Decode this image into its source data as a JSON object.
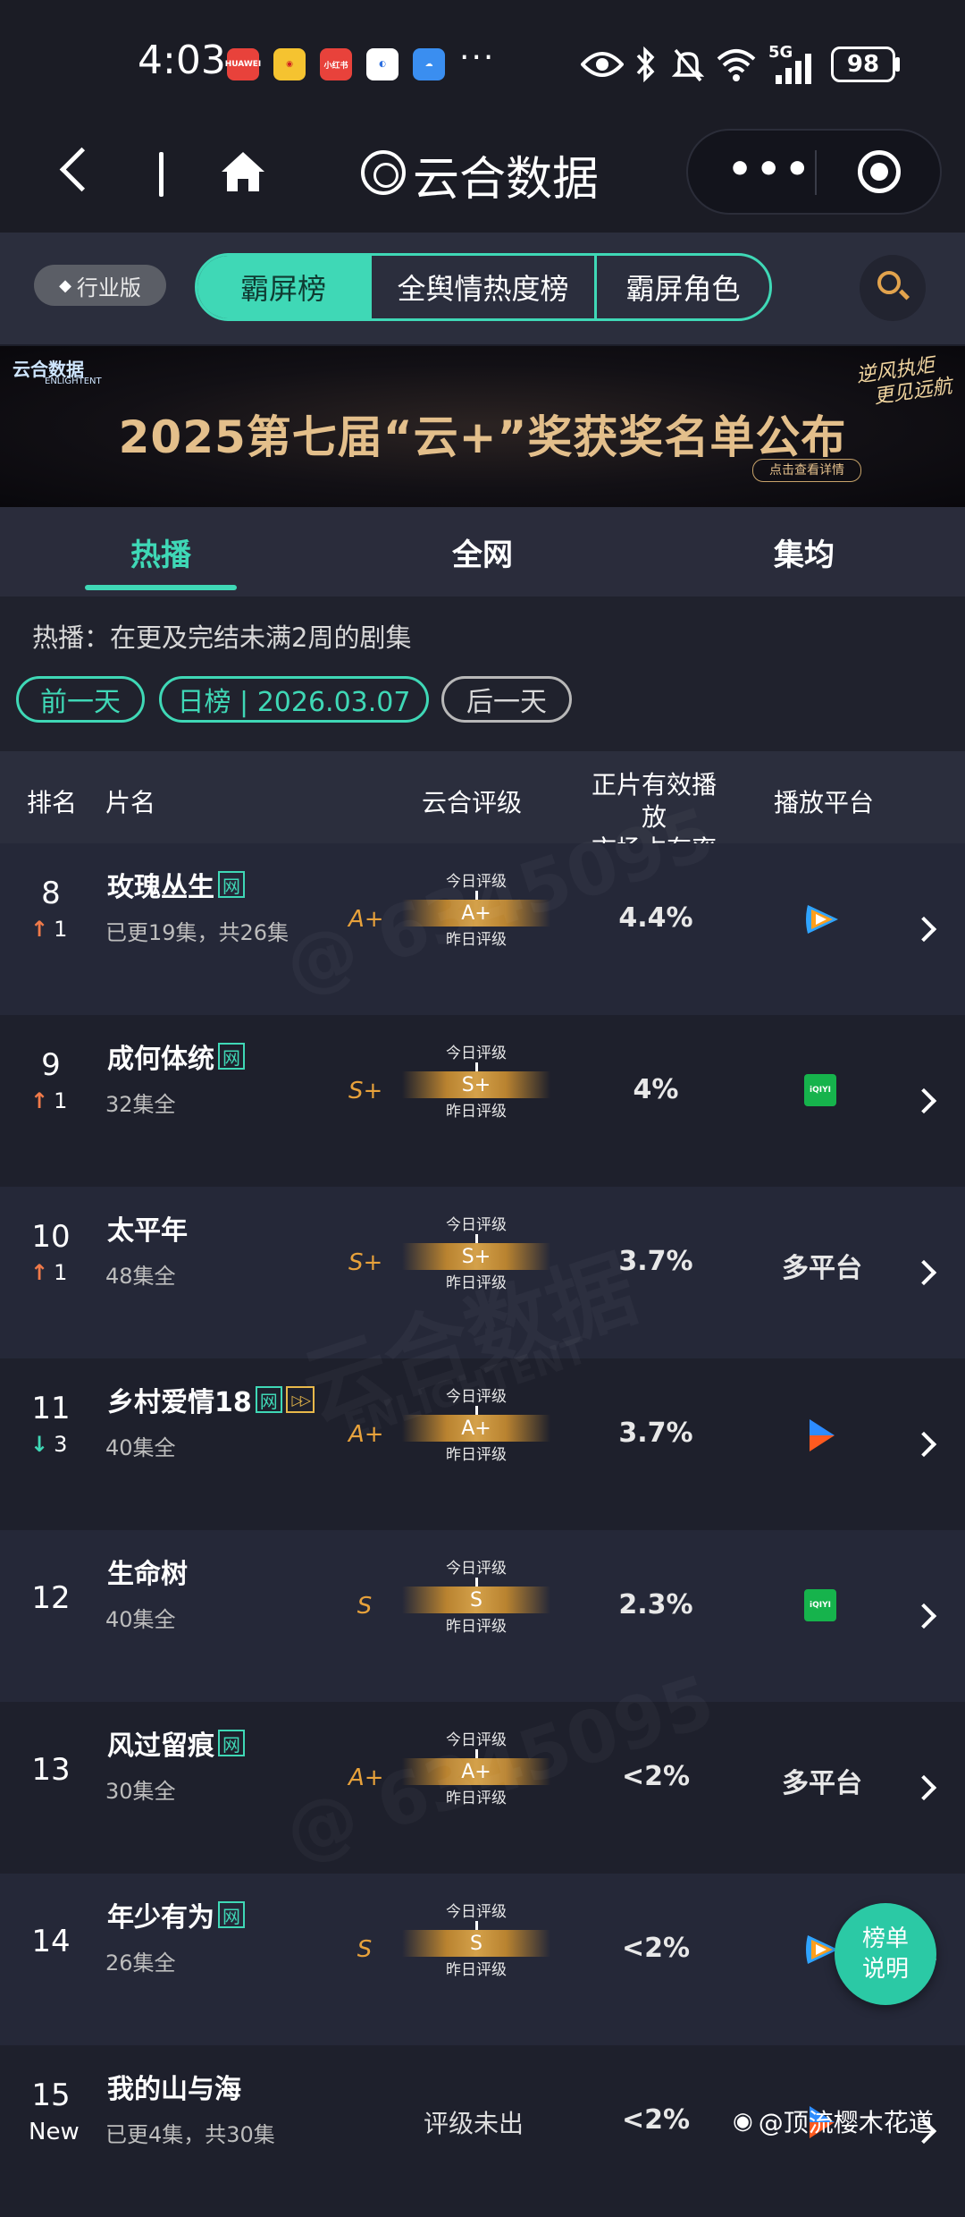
{
  "status_bar": {
    "time": "4:03",
    "notif_apps": [
      "HUAWEI",
      "weibo",
      "小红书",
      "browser",
      "cloud"
    ],
    "overflow": "···",
    "network": "5G",
    "battery": "98"
  },
  "nav": {
    "title": "云合数据",
    "more_label": "•••"
  },
  "top_tabs": {
    "industry_label": "行业版",
    "segments": [
      "霸屏榜",
      "全舆情热度榜",
      "霸屏角色"
    ],
    "active_index": 0
  },
  "banner": {
    "brand": "云合数据",
    "brand_sub": "ENLIGHTENT",
    "headline": "2025第七届“云+”奖获奖名单公布",
    "slogan_line1": "逆风执炬",
    "slogan_line2": "更见远航",
    "cta": "点击查看详情"
  },
  "sub_tabs": {
    "items": [
      "热播",
      "全网",
      "集均"
    ],
    "active_index": 0
  },
  "filter": {
    "note": "热播：在更及完结未满2周的剧集",
    "prev_label": "前一天",
    "date_label": "日榜 | 2026.03.07",
    "next_label": "后一天"
  },
  "table_header": {
    "rank": "排名",
    "title": "片名",
    "rating": "云合评级",
    "share_line1": "正片有效播放",
    "share_line2": "市场占有率",
    "platform": "播放平台"
  },
  "rating_labels": {
    "today": "今日评级",
    "yesterday": "昨日评级",
    "pending": "评级未出"
  },
  "rows": [
    {
      "rank": "8",
      "trend": "up",
      "change": "1",
      "title": "玫瑰丛生",
      "tags": [
        "网"
      ],
      "episodes": "已更19集，共26集",
      "grade": "A+",
      "today": "A+",
      "share": "4.4%",
      "platform": "tencent",
      "platform_text": ""
    },
    {
      "rank": "9",
      "trend": "up",
      "change": "1",
      "title": "成何体统",
      "tags": [
        "网"
      ],
      "episodes": "32集全",
      "grade": "S+",
      "today": "S+",
      "share": "4%",
      "platform": "iqiyi",
      "platform_text": ""
    },
    {
      "rank": "10",
      "trend": "up",
      "change": "1",
      "title": "太平年",
      "tags": [],
      "episodes": "48集全",
      "grade": "S+",
      "today": "S+",
      "share": "3.7%",
      "platform": "multi",
      "platform_text": "多平台"
    },
    {
      "rank": "11",
      "trend": "down",
      "change": "3",
      "title": "乡村爱情18",
      "tags": [
        "网",
        "▷▷"
      ],
      "episodes": "40集全",
      "grade": "A+",
      "today": "A+",
      "share": "3.7%",
      "platform": "youku",
      "platform_text": ""
    },
    {
      "rank": "12",
      "trend": "none",
      "change": "",
      "title": "生命树",
      "tags": [],
      "episodes": "40集全",
      "grade": "S",
      "today": "S",
      "share": "2.3%",
      "platform": "iqiyi",
      "platform_text": ""
    },
    {
      "rank": "13",
      "trend": "none",
      "change": "",
      "title": "风过留痕",
      "tags": [
        "网"
      ],
      "episodes": "30集全",
      "grade": "A+",
      "today": "A+",
      "share": "<2%",
      "platform": "multi",
      "platform_text": "多平台"
    },
    {
      "rank": "14",
      "trend": "none",
      "change": "",
      "title": "年少有为",
      "tags": [
        "网"
      ],
      "episodes": "26集全",
      "grade": "S",
      "today": "S",
      "share": "<2%",
      "platform": "tencent",
      "platform_text": ""
    },
    {
      "rank": "15",
      "trend": "new",
      "change": "New",
      "title": "我的山与海",
      "tags": [],
      "episodes": "已更4集，共30集",
      "grade": "",
      "today": "",
      "share": "<2%",
      "platform": "youku",
      "platform_text": ""
    }
  ],
  "platform_logos": {
    "iqiyi": "iQIYI"
  },
  "floating_button": {
    "line1": "榜单",
    "line2": "说明"
  },
  "watermark": {
    "brand": "云合数据",
    "brand_sub": "ENLIGHTENT",
    "code": "@ 6345095"
  },
  "credit": "@顶流樱木花道",
  "colors": {
    "accent": "#3fd8b6",
    "grade": "#e8a23b",
    "up": "#f07a4a",
    "bg": "#1c1e29"
  }
}
